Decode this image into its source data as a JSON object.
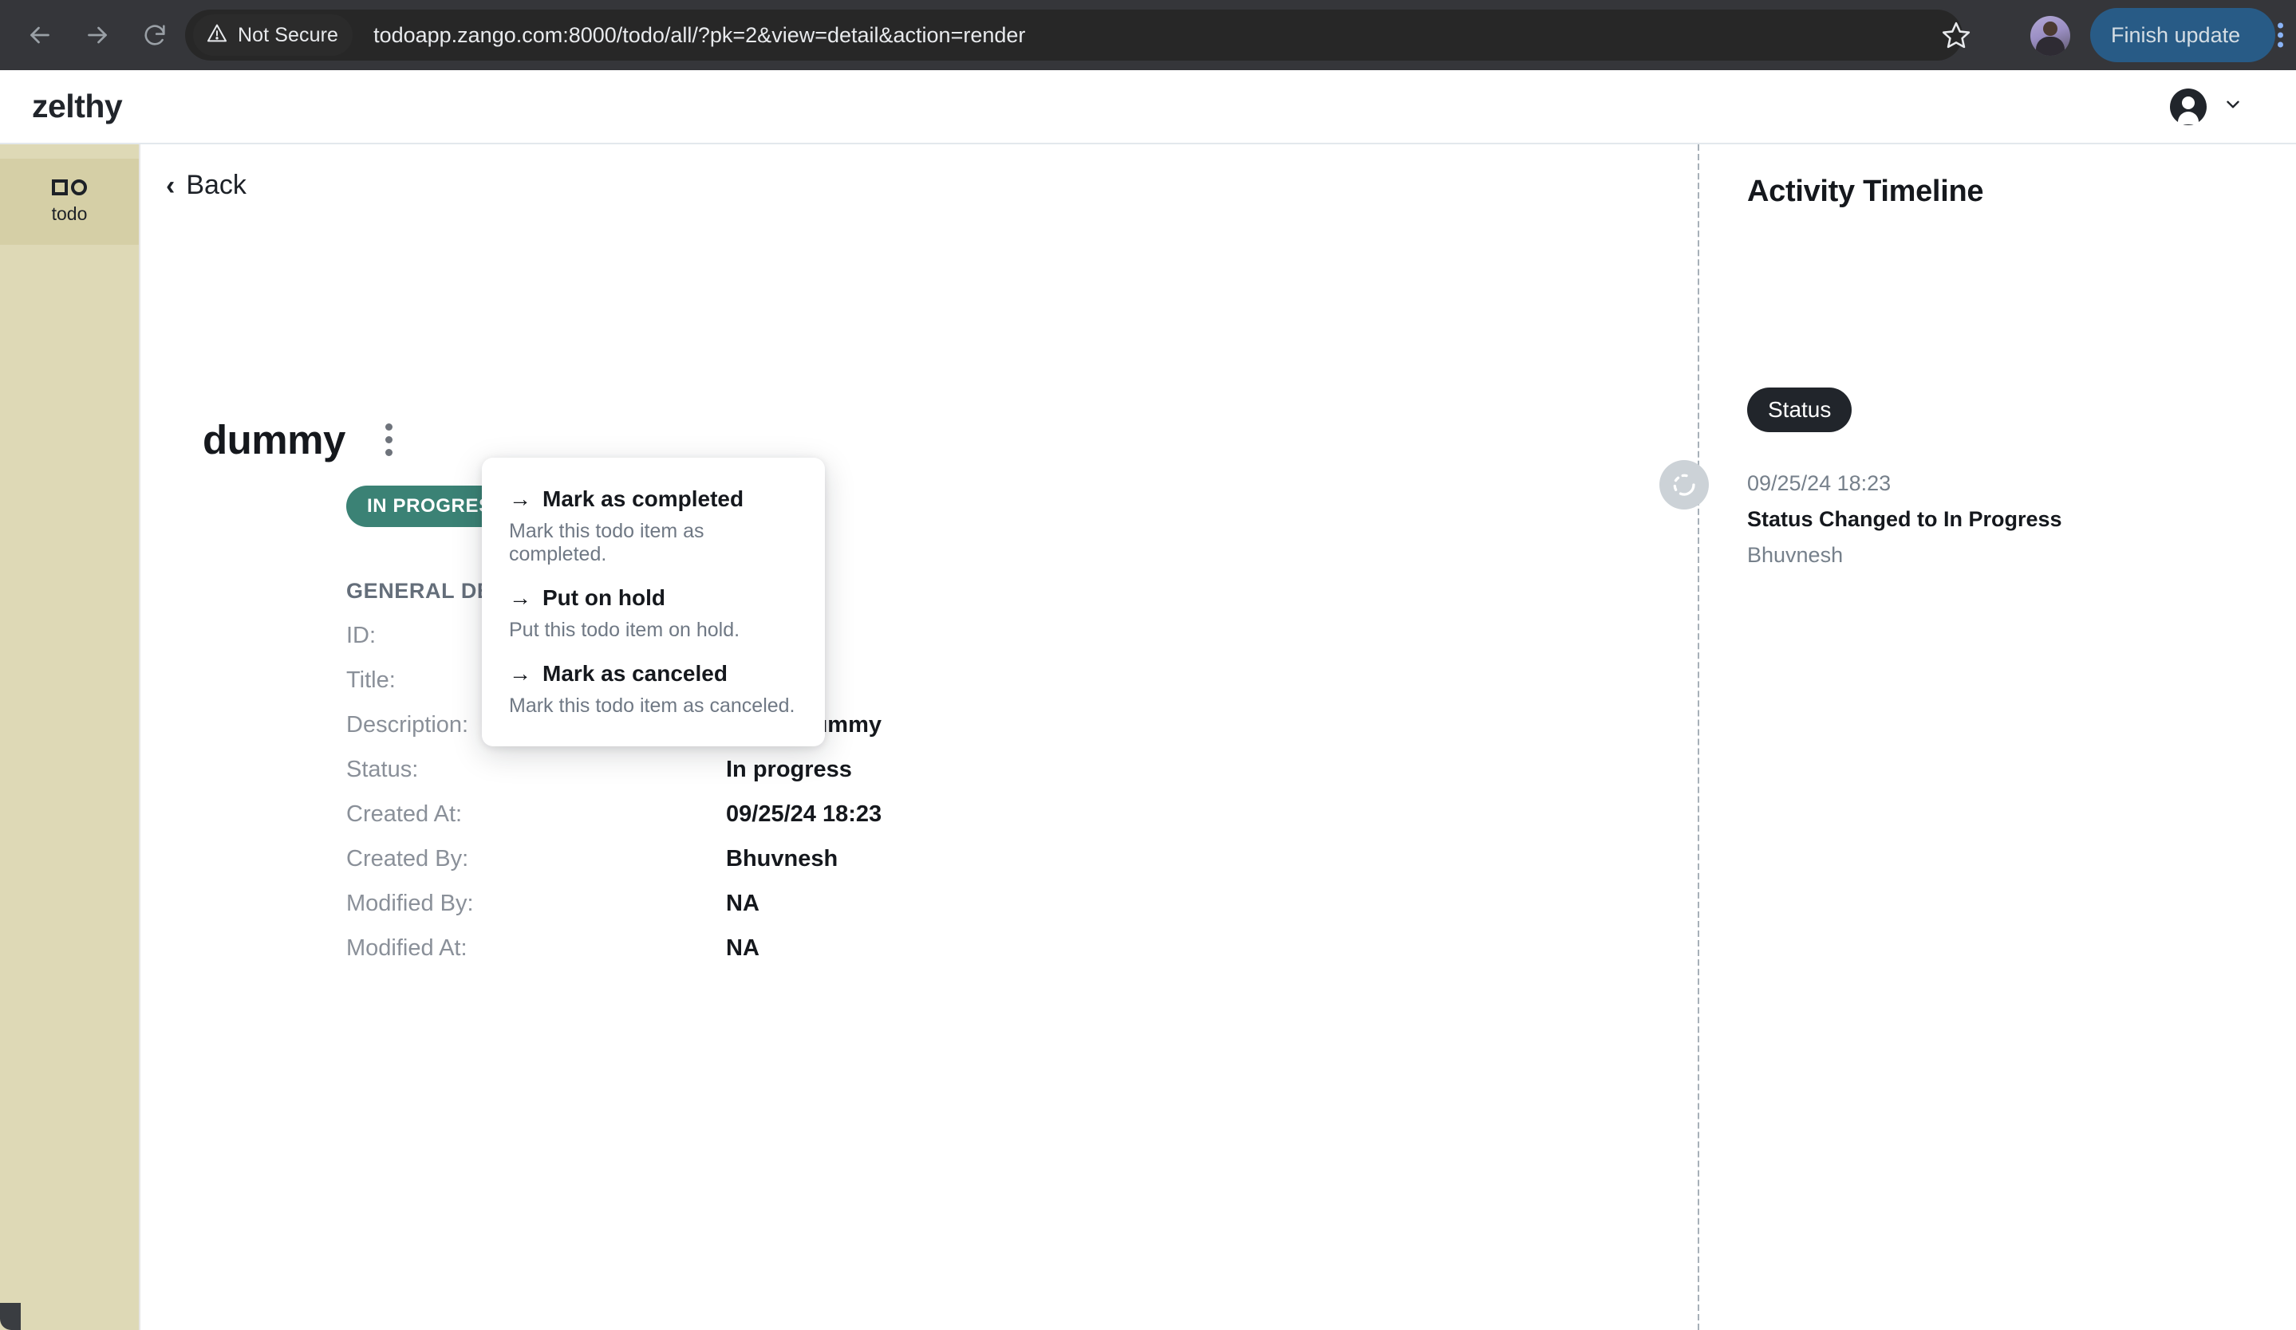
{
  "browser": {
    "back_icon": "arrow-left-icon",
    "forward_icon": "arrow-right-icon",
    "reload_icon": "reload-icon",
    "security_icon": "warning-triangle-icon",
    "security_label": "Not Secure",
    "url": "todoapp.zango.com:8000/todo/all/?pk=2&view=detail&action=render",
    "bookmark_icon": "star-icon",
    "profile_icon": "profile-avatar",
    "update_button_label": "Finish update",
    "menu_icon": "kebab-menu-icon"
  },
  "app_header": {
    "brand": "zelthy",
    "account_icon": "account-circle-icon",
    "chevron_icon": "chevron-down-icon"
  },
  "sidebar": {
    "items": [
      {
        "label": "todo",
        "icon": "square-circle-icon",
        "active": true
      }
    ]
  },
  "main": {
    "back_label": "Back",
    "back_icon": "chevron-left-icon",
    "record_title": "dummy",
    "kebab_icon": "kebab-menu-icon",
    "status_badge": "IN PROGRESS",
    "section_heading": "GENERAL DETAILS",
    "fields": [
      {
        "label": "ID:",
        "value": ""
      },
      {
        "label": "Title:",
        "value": ""
      },
      {
        "label": "Description:",
        "value": "this is dummy"
      },
      {
        "label": "Status:",
        "value": "In progress"
      },
      {
        "label": "Created At:",
        "value": "09/25/24 18:23"
      },
      {
        "label": "Created By:",
        "value": "Bhuvnesh"
      },
      {
        "label": "Modified By:",
        "value": "NA"
      },
      {
        "label": "Modified At:",
        "value": "NA"
      }
    ]
  },
  "dropdown": {
    "arrow_icon": "arrow-right-icon",
    "items": [
      {
        "title": "Mark as completed",
        "description": "Mark this todo item as completed."
      },
      {
        "title": "Put on hold",
        "description": "Put this todo item on hold."
      },
      {
        "title": "Mark as canceled",
        "description": "Mark this todo item as canceled."
      }
    ]
  },
  "timeline": {
    "title": "Activity Timeline",
    "filter_chip": "Status",
    "node_icon": "refresh-circle-icon",
    "entries": [
      {
        "time": "09/25/24 18:23",
        "event": "Status Changed to In Progress",
        "actor": "Bhuvnesh"
      }
    ]
  },
  "colors": {
    "brand_dark": "#21252b",
    "status_in_progress": "#3b8275",
    "sidebar_bg": "#ded9b6",
    "sidebar_active": "#d5cfa6",
    "browser_chrome": "#35363a",
    "update_button": "#285b86"
  }
}
